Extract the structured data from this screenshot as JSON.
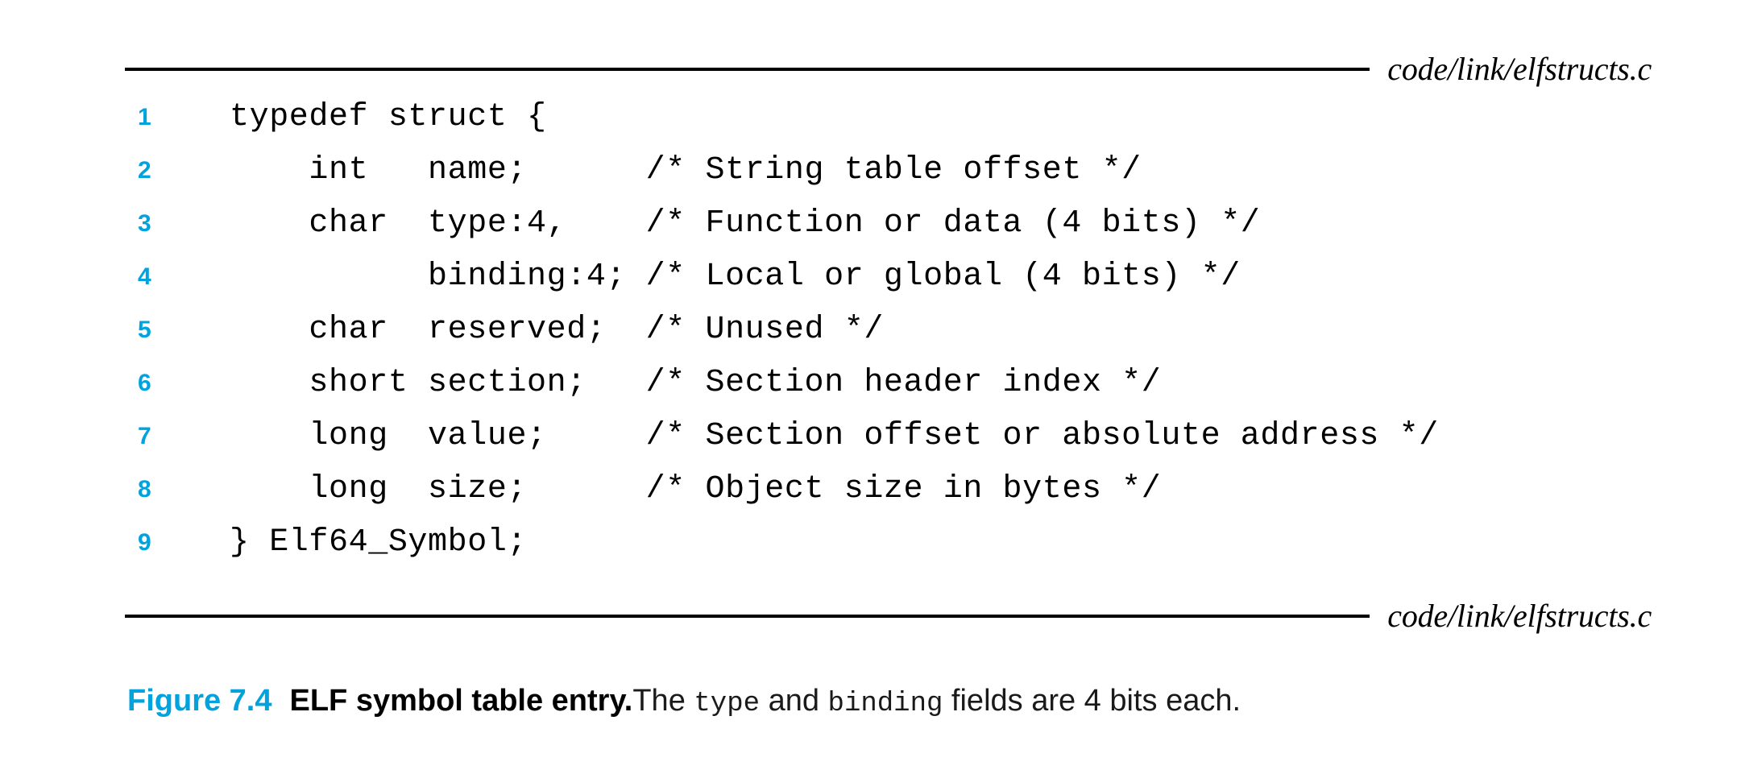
{
  "figure": {
    "source_file_top": "code/link/elfstructs.c",
    "source_file_bottom": "code/link/elfstructs.c",
    "accent_color": "#00a3dd",
    "text_color": "#000000",
    "background_color": "#ffffff"
  },
  "code": {
    "language": "c",
    "lines": [
      {
        "n": "1",
        "text": "typedef struct {"
      },
      {
        "n": "2",
        "text": "    int   name;      /* String table offset */"
      },
      {
        "n": "3",
        "text": "    char  type:4,    /* Function or data (4 bits) */"
      },
      {
        "n": "4",
        "text": "          binding:4; /* Local or global (4 bits) */"
      },
      {
        "n": "5",
        "text": "    char  reserved;  /* Unused */"
      },
      {
        "n": "6",
        "text": "    short section;   /* Section header index */"
      },
      {
        "n": "7",
        "text": "    long  value;     /* Section offset or absolute address */"
      },
      {
        "n": "8",
        "text": "    long  size;      /* Object size in bytes */"
      },
      {
        "n": "9",
        "text": "} Elf64_Symbol;"
      }
    ]
  },
  "caption": {
    "label": "Figure 7.4",
    "title": "ELF symbol table entry.",
    "desc_part_1": "The ",
    "code_term_1": "type",
    "desc_part_2": " and ",
    "code_term_2": "binding",
    "desc_part_3": " fields are 4 bits each."
  }
}
